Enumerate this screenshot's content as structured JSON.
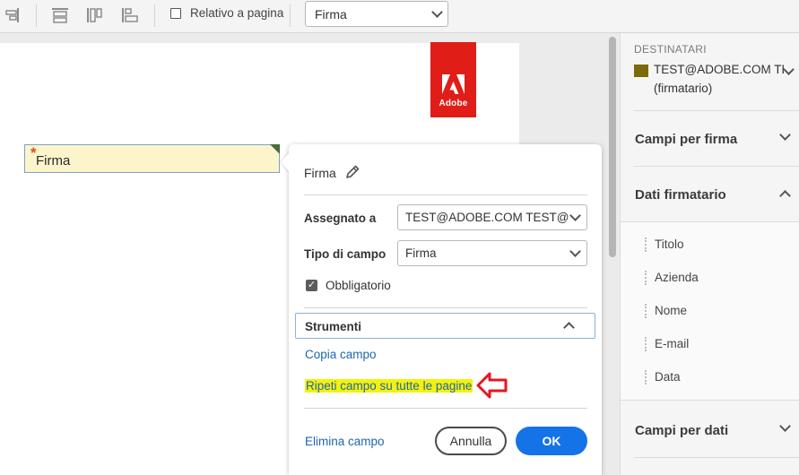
{
  "toolbar": {
    "relative_checkbox_label": "Relativo a pagina",
    "field_type_select": "Firma"
  },
  "document": {
    "logo_text": "Adobe",
    "field_label": "Firma",
    "required_marker": "*"
  },
  "popup": {
    "title": "Firma",
    "assigned_label": "Assegnato a",
    "assigned_value": "TEST@ADOBE.COM TEST@ADOBE.COM",
    "field_type_label": "Tipo di campo",
    "field_type_value": "Firma",
    "required_label": "Obbligatorio",
    "tools_label": "Strumenti",
    "copy_field": "Copia campo",
    "repeat_field": "Ripeti campo su tutte le pagine",
    "delete_field": "Elimina campo",
    "cancel": "Annulla",
    "ok": "OK"
  },
  "right_panel": {
    "recipients_heading": "DESTINATARI",
    "recipient_email": "TEST@ADOBE.COM TE...",
    "recipient_role": "(firmatario)",
    "sections": {
      "signature_fields": "Campi per firma",
      "signer_data": "Dati firmatario",
      "data_fields": "Campi per dati"
    },
    "signer_items": [
      "Titolo",
      "Azienda",
      "Nome",
      "E-mail",
      "Data"
    ]
  },
  "colors": {
    "accent": "#1473e6",
    "link": "#1d66b3",
    "adobe_red": "#e01d17",
    "recipient_swatch": "#7d6a08",
    "field_fill": "#fcf5cb",
    "highlight": "#f4f20a",
    "annotation_arrow": "#e3191f"
  }
}
